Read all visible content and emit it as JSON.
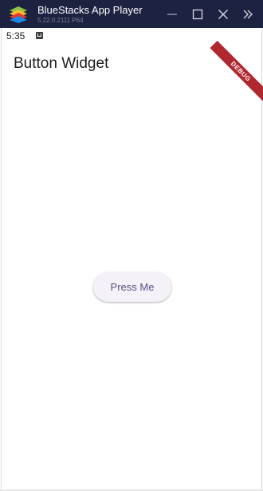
{
  "window": {
    "title": "BlueStacks App Player",
    "version": "5.22.0.2111 P64",
    "controls": {
      "minimize": "minimize-icon",
      "maximize": "maximize-icon",
      "close": "close-icon",
      "more": "double-chevron-right-icon"
    },
    "titlebar_color": "#1d2240"
  },
  "statusbar": {
    "time": "5:35",
    "icon": "notification-a-icon"
  },
  "appbar": {
    "title": "Button Widget"
  },
  "main": {
    "button_label": "Press Me",
    "button_text_color": "#5a5283",
    "button_bg_color": "#f4f1f8"
  },
  "debug_banner": {
    "label": "DEBUG",
    "color": "#b0272f"
  }
}
